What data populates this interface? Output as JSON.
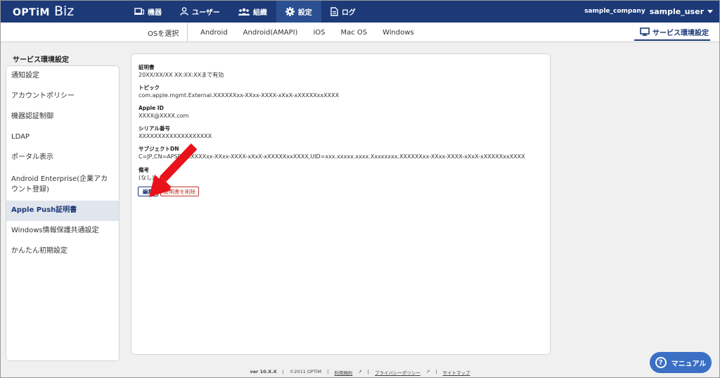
{
  "topbar": {
    "logo_main": "OPTiM",
    "logo_sub": "Biz",
    "nav": [
      {
        "label": "機器",
        "icon": "device-icon"
      },
      {
        "label": "ユーザー",
        "icon": "user-icon"
      },
      {
        "label": "組織",
        "icon": "organization-icon"
      },
      {
        "label": "設定",
        "icon": "gear-icon",
        "active": true
      },
      {
        "label": "ログ",
        "icon": "log-icon"
      }
    ],
    "company": "sample_company",
    "user": "sample_user"
  },
  "osbar": {
    "select_label": "OSを選択",
    "tabs": [
      "Android",
      "Android(AMAPI)",
      "iOS",
      "Mac OS",
      "Windows"
    ],
    "service_button": "サービス環境設定"
  },
  "sidebar": {
    "title": "サービス環境設定",
    "items": [
      {
        "label": "通知設定"
      },
      {
        "label": "アカウントポリシー"
      },
      {
        "label": "機器認証制御"
      },
      {
        "label": "LDAP"
      },
      {
        "label": "ポータル表示"
      },
      {
        "label": "Android Enterprise(企業アカウント登録)"
      },
      {
        "label": "Apple Push証明書",
        "active": true
      },
      {
        "label": "Windows情報保護共通設定"
      },
      {
        "label": "かんたん初期設定"
      }
    ]
  },
  "certificate": {
    "fields": [
      {
        "label": "証明書",
        "value": "20XX/XX/XX XX:XX:XXまで有効"
      },
      {
        "label": "トピック",
        "value": "com.apple.mgmt.External.XXXXXXxx-XXxx-XXXX-xXxX-xXXXXXxxXXXX"
      },
      {
        "label": "Apple ID",
        "value": "XXXX@XXXX.com"
      },
      {
        "label": "シリアル番号",
        "value": "XXXXXXXXXXXXXXXXXXX"
      },
      {
        "label": "サブジェクトDN",
        "value": "C=JP,CN=APSP:XXXXXXxx-XXxx-XXXX-xXxX-xXXXXXxxXXXX,UID=xxx.xxxxx.xxxx.Xxxxxxxx.XXXXXXxx-XXxx-XXXX-xXxX-xXXXXXxxXXXX"
      },
      {
        "label": "備考",
        "value": "(なし)"
      }
    ],
    "edit_button": "編集",
    "delete_button": "証明書を削除"
  },
  "footer": {
    "version": "ver 10.X.X",
    "copyright": "©2011 OPTiM",
    "terms": "利用規約",
    "privacy": "プライバシーポリシー",
    "sitemap": "サイトマップ"
  },
  "manual_button": "マニュアル",
  "colors": {
    "brand": "#1c3a78",
    "accent": "#3a6fc4",
    "danger": "#c0392b",
    "arrow": "#e8121b"
  }
}
